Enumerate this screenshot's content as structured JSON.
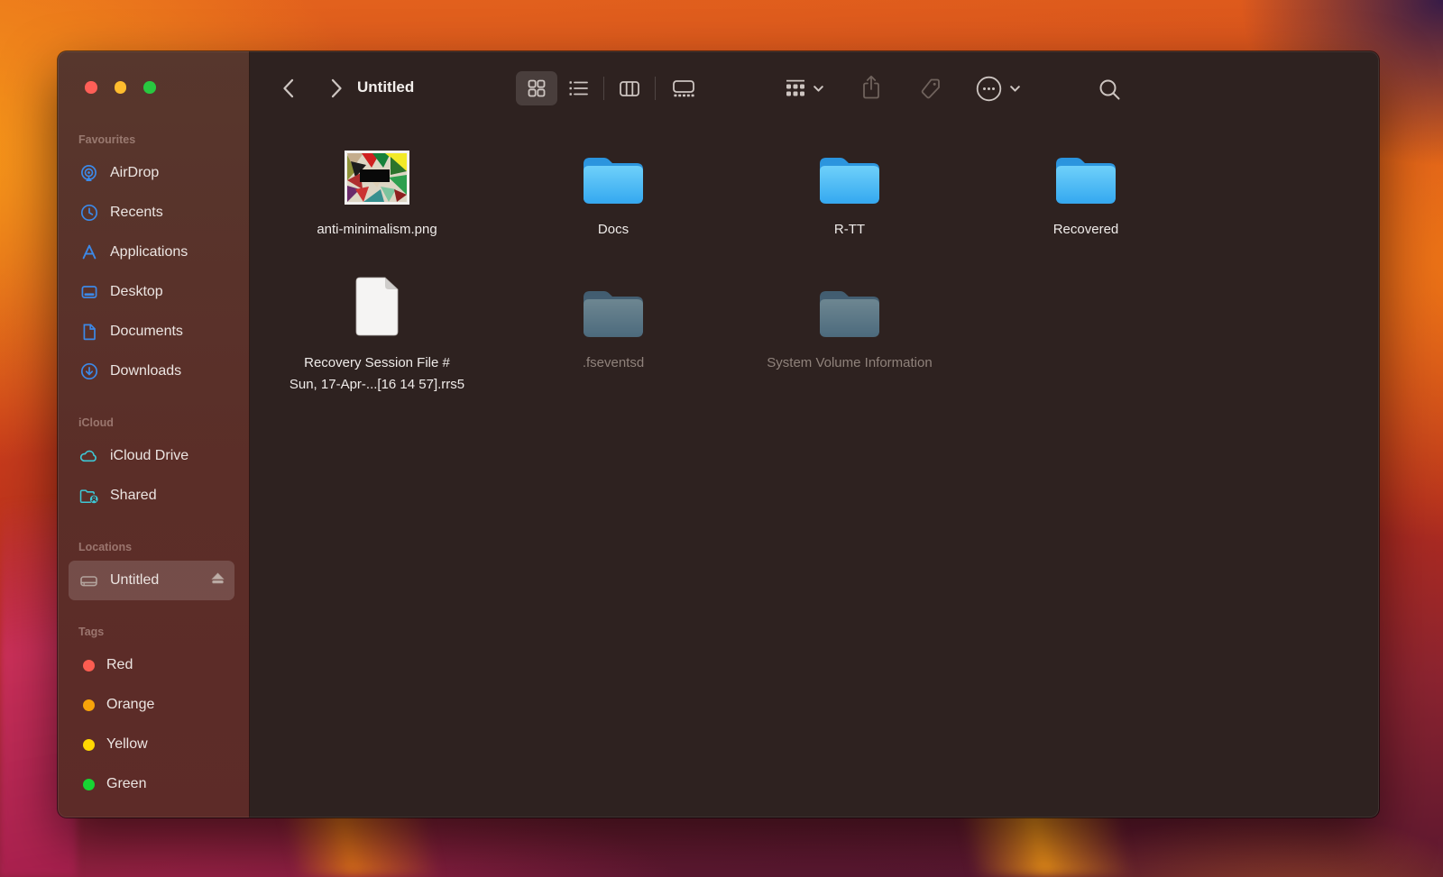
{
  "titlebar": {
    "title": "Untitled"
  },
  "toolbar": {
    "view_modes": [
      "icons",
      "list",
      "columns",
      "gallery"
    ],
    "selected_view": "icons",
    "icons": [
      "back",
      "forward",
      "group",
      "share",
      "tags",
      "more",
      "search"
    ]
  },
  "sidebar": {
    "sections": [
      {
        "label": "Favourites",
        "items": [
          {
            "label": "AirDrop",
            "icon": "airdrop"
          },
          {
            "label": "Recents",
            "icon": "clock"
          },
          {
            "label": "Applications",
            "icon": "app-store-a"
          },
          {
            "label": "Desktop",
            "icon": "desktop"
          },
          {
            "label": "Documents",
            "icon": "document"
          },
          {
            "label": "Downloads",
            "icon": "download-circle"
          }
        ]
      },
      {
        "label": "iCloud",
        "items": [
          {
            "label": "iCloud Drive",
            "icon": "cloud"
          },
          {
            "label": "Shared",
            "icon": "shared-folder"
          }
        ]
      },
      {
        "label": "Locations",
        "items": [
          {
            "label": "Untitled",
            "icon": "hard-drive",
            "selected": true,
            "eject": true
          }
        ]
      },
      {
        "label": "Tags",
        "items": [
          {
            "label": "Red",
            "color": "#fc5d51"
          },
          {
            "label": "Orange",
            "color": "#f7a30a"
          },
          {
            "label": "Yellow",
            "color": "#ffd702"
          },
          {
            "label": "Green",
            "color": "#17d433"
          }
        ]
      }
    ]
  },
  "files": {
    "items": [
      {
        "name": "anti-minimalism.png",
        "kind": "image"
      },
      {
        "name": "Docs",
        "kind": "folder"
      },
      {
        "name": "R-TT",
        "kind": "folder"
      },
      {
        "name": "Recovered",
        "kind": "folder"
      },
      {
        "name": "Recovery Session File # Sun, 17-Apr-...[16 14 57].rrs5",
        "kind": "document",
        "label_line1": "Recovery Session File #",
        "label_line2": "Sun, 17-Apr-...[16 14 57].rrs5"
      },
      {
        "name": ".fseventsd",
        "kind": "folder",
        "hidden": true
      },
      {
        "name": "System Volume Information",
        "kind": "folder",
        "hidden": true
      }
    ]
  },
  "colors": {
    "accent_blue": "#3c89e8",
    "icloud_teal": "#3ec8d6",
    "folder_blue": "#50c0f5",
    "traffic_red": "#ff5f57",
    "traffic_yellow": "#febc2e",
    "traffic_green": "#28c840",
    "sidebar_bg": "#5b2e28",
    "content_bg": "#2e2220"
  }
}
